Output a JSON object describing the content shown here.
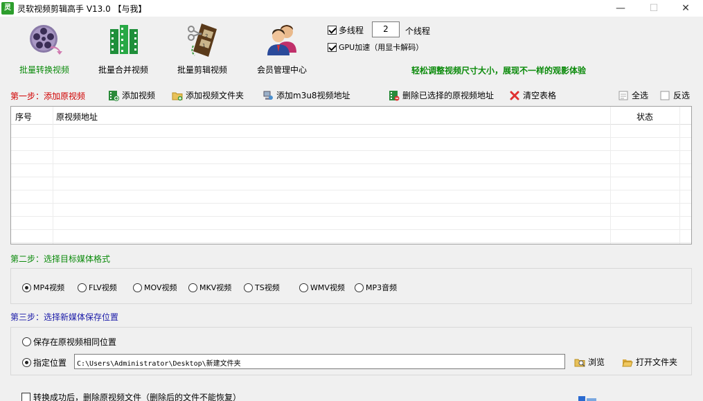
{
  "window": {
    "title": "灵软视频剪辑高手 V13.0 【与我】",
    "app_icon_glyph": "灵"
  },
  "toolbar": {
    "items": [
      {
        "label": "批量转换视频",
        "icon": "film-reel-icon",
        "active": true
      },
      {
        "label": "批量合并视频",
        "icon": "film-strip-icon",
        "active": false
      },
      {
        "label": "批量剪辑视频",
        "icon": "scissors-film-icon",
        "active": false
      },
      {
        "label": "会员管理中心",
        "icon": "users-icon",
        "active": false
      }
    ]
  },
  "options": {
    "multithread_label": "多线程",
    "multithread_checked": true,
    "thread_count": "2",
    "thread_unit": "个线程",
    "gpu_label": "GPU加速（用显卡解码）",
    "gpu_checked": true
  },
  "slogan": "轻松调整视频尺寸大小，展现不一样的观影体验",
  "step1": {
    "title": "第一步：添加原视频",
    "add_video": "添加视频",
    "add_folder": "添加视频文件夹",
    "add_m3u8": "添加m3u8视频地址",
    "delete_selected": "删除已选择的原视频地址",
    "clear_table": "清空表格",
    "select_all": "全选",
    "invert_select": "反选"
  },
  "table": {
    "columns": [
      "序号",
      "原视频地址",
      "状态"
    ],
    "rows": []
  },
  "step2": {
    "title": "第二步：选择目标媒体格式",
    "formats": [
      {
        "label": "MP4视频",
        "selected": true
      },
      {
        "label": "FLV视频",
        "selected": false
      },
      {
        "label": "MOV视频",
        "selected": false
      },
      {
        "label": "MKV视频",
        "selected": false
      },
      {
        "label": "TS视频",
        "selected": false
      },
      {
        "label": "WMV视频",
        "selected": false
      },
      {
        "label": "MP3音频",
        "selected": false
      }
    ]
  },
  "step3": {
    "title": "第三步：选择新媒体保存位置",
    "same_location": "保存在原视频相同位置",
    "same_selected": false,
    "custom_location": "指定位置",
    "custom_selected": true,
    "path": "C:\\Users\\Administrator\\Desktop\\新建文件夹",
    "browse": "浏览",
    "open_folder": "打开文件夹"
  },
  "delete_after": {
    "label": "转换成功后，删除原视频文件（删除后的文件不能恢复）",
    "checked": false
  },
  "colors": {
    "green": "#0a8a0a",
    "red": "#d00000",
    "blue": "#1a1aa8"
  }
}
